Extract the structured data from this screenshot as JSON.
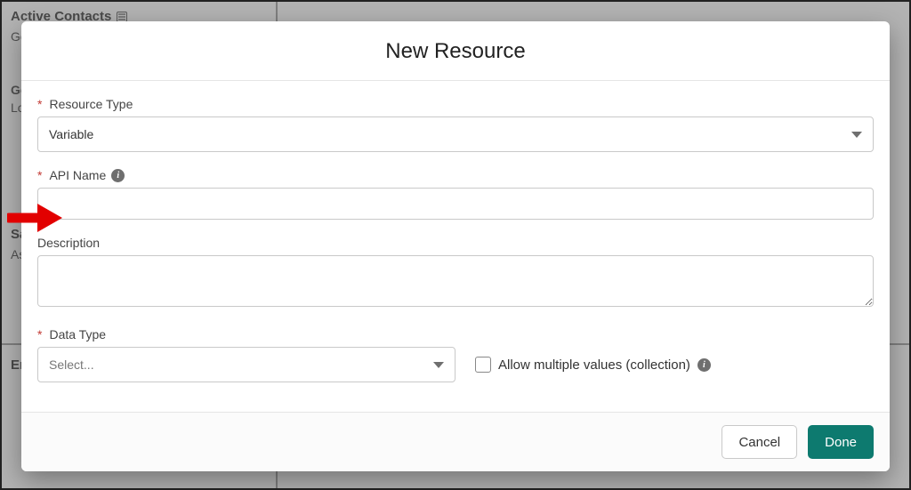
{
  "background": {
    "title": "Active Contacts",
    "rows": [
      "Ge",
      "Ge",
      "Loc"
    ],
    "save_label": "Sav",
    "assign_label": "Ass",
    "end_label": "En"
  },
  "modal": {
    "title": "New Resource",
    "fields": {
      "resource_type": {
        "label": "Resource Type",
        "value": "Variable",
        "required": true
      },
      "api_name": {
        "label": "API Name",
        "value": "",
        "required": true
      },
      "description": {
        "label": "Description",
        "value": "",
        "required": false
      },
      "data_type": {
        "label": "Data Type",
        "placeholder": "Select...",
        "required": true
      },
      "allow_multiple": {
        "label": "Allow multiple values (collection)",
        "checked": false
      }
    },
    "buttons": {
      "cancel": "Cancel",
      "done": "Done"
    }
  }
}
